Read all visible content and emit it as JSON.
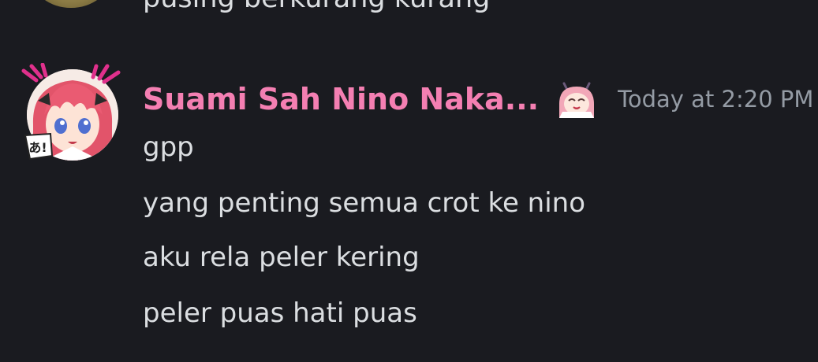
{
  "previous_message": {
    "text": "pusing berkurang kurang"
  },
  "message": {
    "username": "Suami Sah Nino Naka...",
    "timestamp": "Today at 2:20 PM",
    "avatar_icon": "anime-avatar-icon",
    "badge_icon": "speech-badge-icon",
    "tag_icon": "anime-chibi-icon",
    "username_color": "#f47fb2",
    "lines": [
      "gpp",
      "yang penting semua crot ke nino",
      "aku rela peler kering",
      "peler puas hati puas"
    ]
  }
}
